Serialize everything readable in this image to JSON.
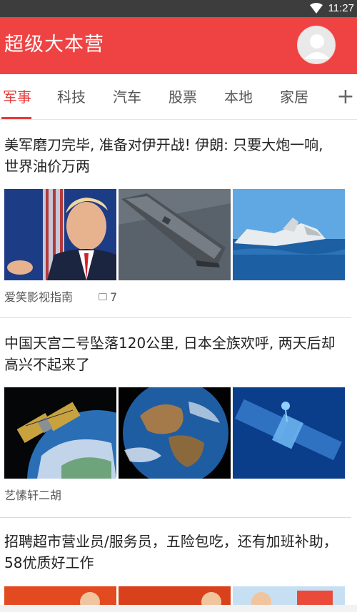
{
  "status_bar": {
    "time": "11:27",
    "wifi_icon": "wifi-icon"
  },
  "app_bar": {
    "title": "超级大本营",
    "avatar_icon": "user-avatar-icon",
    "accent_color": "#ef4343"
  },
  "tabs": [
    {
      "label": "军事",
      "active": true
    },
    {
      "label": "科技",
      "active": false
    },
    {
      "label": "汽车",
      "active": false
    },
    {
      "label": "股票",
      "active": false
    },
    {
      "label": "本地",
      "active": false
    },
    {
      "label": "家居",
      "active": false
    }
  ],
  "tabs_add_label": "+",
  "articles": [
    {
      "headline": "美军磨刀完毕, 准备对伊开战! 伊朗: 只要大炮一响, 世界油价万两",
      "source": "爱笑影视指南",
      "comment_count": "7",
      "images": [
        "politician-speaking",
        "aircraft-carrier",
        "sinking-ship"
      ]
    },
    {
      "headline": "中国天宫二号坠落120公里, 日本全族欢呼, 两天后却高兴不起来了",
      "source": "艺愫轩二胡",
      "images": [
        "satellite-over-earth",
        "earth-from-space",
        "blue-satellite-render"
      ]
    },
    {
      "headline": "招聘超市营业员/服务员，五险包吃，还有加班补助，58优质好工作",
      "images": [
        "recruitment-banner-1",
        "recruitment-banner-2",
        "recruitment-banner-3"
      ]
    }
  ]
}
